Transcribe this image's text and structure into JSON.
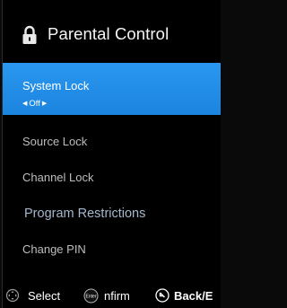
{
  "header": {
    "title": "Parental Control",
    "icon": "lock-icon"
  },
  "menu": {
    "items": [
      {
        "label": "System Lock",
        "value": "Off"
      },
      {
        "label": "Source Lock"
      },
      {
        "label": "Channel Lock"
      },
      {
        "label": "Program Restrictions"
      },
      {
        "label": "Change PIN"
      }
    ]
  },
  "footer": {
    "select_label": "Select",
    "confirm_label": "nfirm",
    "enter_icon_text": "Enter",
    "back_label": "Back/E"
  },
  "colors": {
    "accent": "#1e88e5",
    "background": "#000000"
  }
}
